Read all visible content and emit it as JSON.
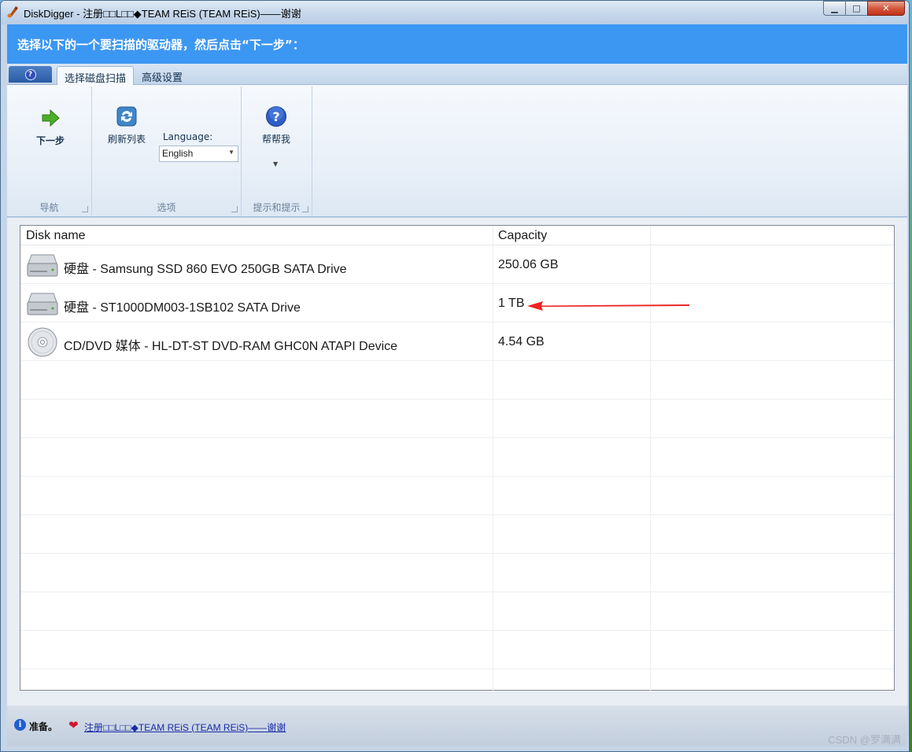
{
  "window": {
    "title": "DiskDigger - 注册□□L□□◆TEAM REiS (TEAM REiS)——谢谢",
    "minimize": "▁",
    "maximize": "□",
    "close": "✕"
  },
  "instruction": "选择以下的一个要扫描的驱动器，然后点击“下一步”：",
  "tabs": [
    {
      "label": "选择磁盘扫描",
      "active": true
    },
    {
      "label": "高级设置",
      "active": false
    }
  ],
  "app_button_icon": "?",
  "ribbon": {
    "nav_group": {
      "label": "导航",
      "next_button": "下一步"
    },
    "options_group": {
      "label": "选项",
      "refresh_button": "刷新列表",
      "language_label": "Language:",
      "language_value": "English"
    },
    "help_group": {
      "label": "提示和提示",
      "help_button": "帮帮我"
    }
  },
  "list": {
    "columns": [
      "Disk name",
      "Capacity"
    ],
    "rows": [
      {
        "icon": "hard-drive-icon",
        "name": "硬盘 - Samsung SSD 860 EVO 250GB SATA Drive",
        "capacity": "250.06 GB"
      },
      {
        "icon": "hard-drive-icon",
        "name": "硬盘 - ST1000DM003-1SB102 SATA Drive",
        "capacity": "1 TB"
      },
      {
        "icon": "cd-dvd-icon",
        "name": "CD/DVD 媒体 - HL-DT-ST DVD-RAM GHC0N ATAPI Device",
        "capacity": "4.54 GB"
      }
    ]
  },
  "status": {
    "text": "准备。",
    "link": "注册□□L□□◆TEAM REiS (TEAM REiS)——谢谢"
  },
  "watermark": "CSDN @罗满满",
  "colors": {
    "instruction_bg": "#3c97f3",
    "annotation_arrow": "#ee2222"
  }
}
